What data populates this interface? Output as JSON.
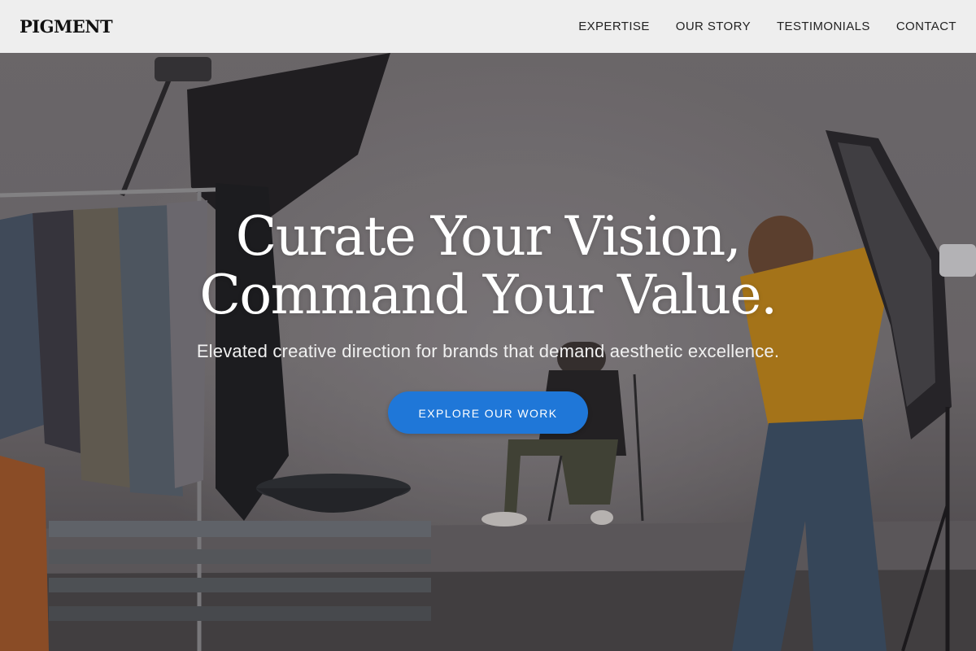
{
  "brand": {
    "logo": "PIGMENT"
  },
  "nav": {
    "items": [
      {
        "label": "EXPERTISE"
      },
      {
        "label": "OUR STORY"
      },
      {
        "label": "TESTIMONIALS"
      },
      {
        "label": "CONTACT"
      }
    ]
  },
  "hero": {
    "headline_line1": "Curate Your Vision,",
    "headline_line2": "Command Your Value.",
    "subheadline": "Elevated creative direction for brands that demand aesthetic excellence.",
    "cta_label": "EXPLORE OUR WORK"
  },
  "colors": {
    "accent": "#1f77d8",
    "navbar_bg": "#f3f3f3",
    "text_light": "#ffffff"
  }
}
